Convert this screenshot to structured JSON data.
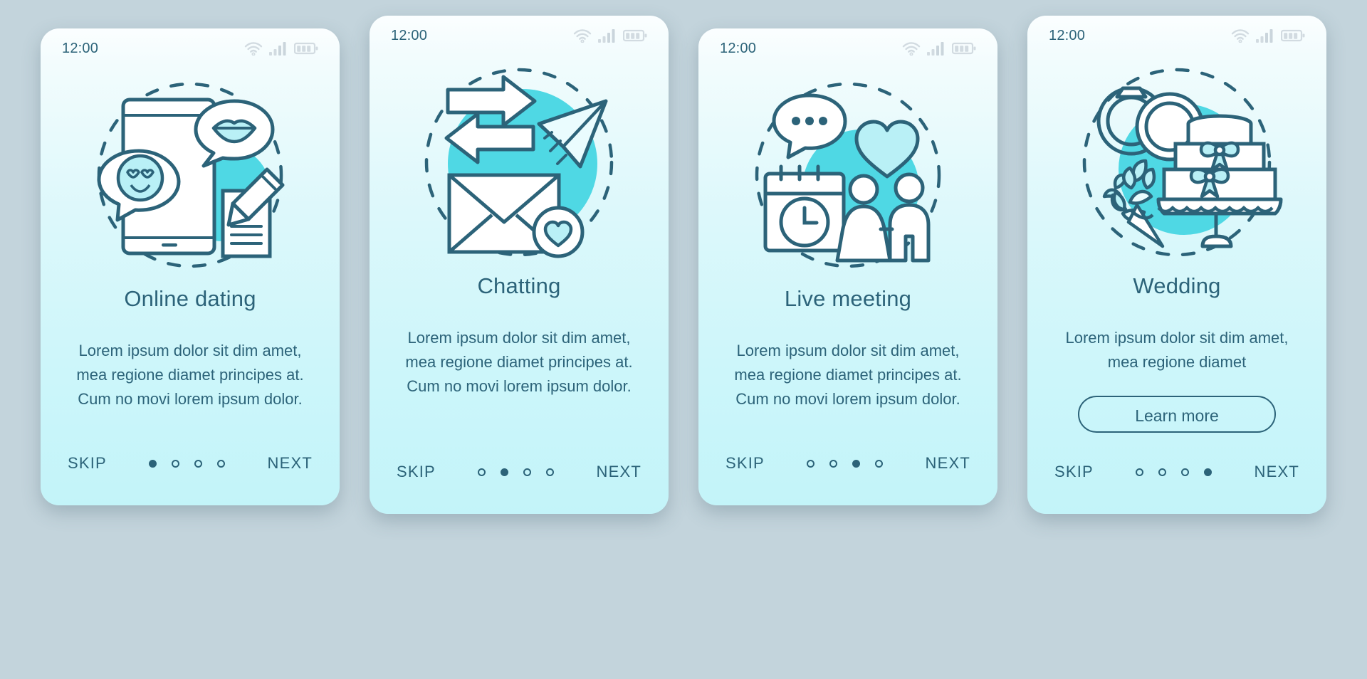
{
  "meta": {
    "background_color": "#c3d4dc",
    "card_gradient_top": "#fbfeff",
    "card_gradient_bottom": "#c3f4f9",
    "ink_color": "#2c6379",
    "accent_color": "#4fd8e4",
    "status_icon_color": "#d0dae0"
  },
  "screens": [
    {
      "status": {
        "time": "12:00",
        "wifi": "wifi-icon",
        "signal": "signal-icon",
        "battery": "battery-icon"
      },
      "illustration": "online-dating-illustration",
      "illustration_parts": [
        "smartphone",
        "speech-bubble-lips",
        "speech-bubble-smiley-heart-eyes",
        "notepad",
        "pencil",
        "dashed-circle",
        "teal-blob"
      ],
      "title": "Online dating",
      "description": "Lorem ipsum dolor sit dim amet, mea regione diamet principes at. Cum no movi lorem ipsum dolor.",
      "has_button": false,
      "button_label": "",
      "skip_label": "SKIP",
      "next_label": "NEXT",
      "dots_total": 4,
      "dot_active": 0
    },
    {
      "status": {
        "time": "12:00",
        "wifi": "wifi-icon",
        "signal": "signal-icon",
        "battery": "battery-icon"
      },
      "illustration": "chatting-illustration",
      "illustration_parts": [
        "exchange-arrows",
        "paper-plane",
        "envelope",
        "heart-badge",
        "dashed-circle",
        "teal-blob"
      ],
      "title": "Chatting",
      "description": "Lorem ipsum dolor sit dim amet, mea regione diamet principes at. Cum no movi lorem ipsum dolor.",
      "has_button": false,
      "button_label": "",
      "skip_label": "SKIP",
      "next_label": "NEXT",
      "dots_total": 4,
      "dot_active": 1
    },
    {
      "status": {
        "time": "12:00",
        "wifi": "wifi-icon",
        "signal": "signal-icon",
        "battery": "battery-icon"
      },
      "illustration": "live-meeting-illustration",
      "illustration_parts": [
        "speech-bubble-ellipsis",
        "heart",
        "calendar-clock",
        "couple-holding-hands",
        "dashed-circle",
        "teal-blob"
      ],
      "title": "Live meeting",
      "description": "Lorem ipsum dolor sit dim amet, mea regione diamet principes at. Cum no movi lorem ipsum dolor.",
      "has_button": false,
      "button_label": "",
      "skip_label": "SKIP",
      "next_label": "NEXT",
      "dots_total": 4,
      "dot_active": 2
    },
    {
      "status": {
        "time": "12:00",
        "wifi": "wifi-icon",
        "signal": "signal-icon",
        "battery": "battery-icon"
      },
      "illustration": "wedding-illustration",
      "illustration_parts": [
        "wedding-rings",
        "tulip-bouquet",
        "tiered-cake",
        "dashed-circle",
        "teal-blob"
      ],
      "title": "Wedding",
      "description": "Lorem ipsum dolor sit dim amet, mea regione diamet",
      "has_button": true,
      "button_label": "Learn more",
      "skip_label": "SKIP",
      "next_label": "NEXT",
      "dots_total": 4,
      "dot_active": 3
    }
  ]
}
